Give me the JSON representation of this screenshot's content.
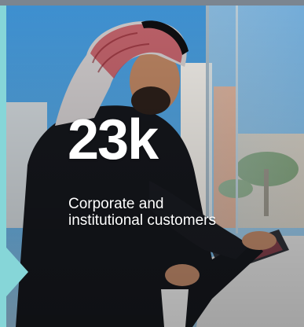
{
  "stat": {
    "value": "23k",
    "label": "Corporate and institutional customers"
  },
  "theme": {
    "accent": "#86d6d8",
    "text": "#ffffff",
    "top_bar": "#7b8590"
  },
  "image": {
    "subject": "man-in-red-checkered-headscarf-using-kiosk-photo"
  }
}
